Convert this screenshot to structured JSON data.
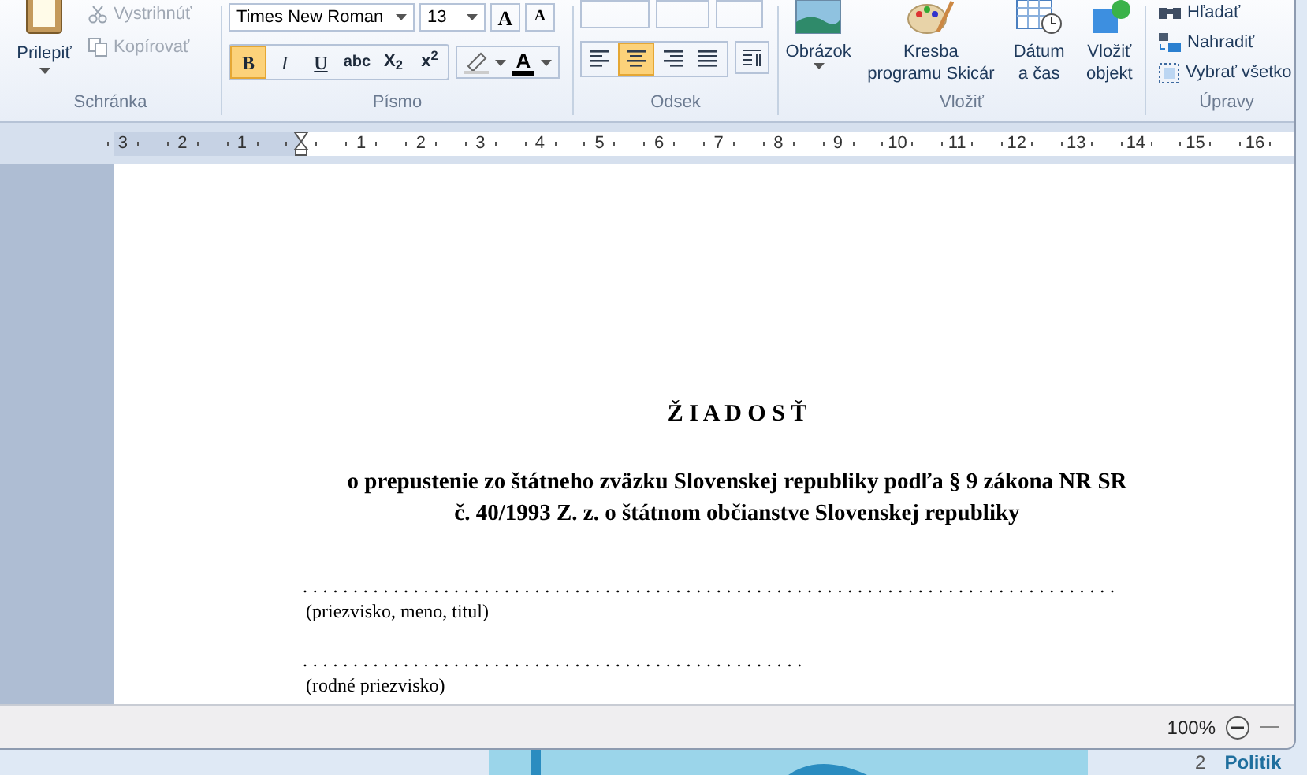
{
  "ribbon": {
    "clipboard": {
      "paste": "Prilepiť",
      "cut": {
        "label": "Vystrihnúť",
        "disabled": true
      },
      "copy": {
        "label": "Kopírovať",
        "disabled": true
      },
      "group": "Schránka"
    },
    "font": {
      "family": "Times New Roman",
      "size": "13",
      "grow": "A",
      "shrink": "A",
      "format_buttons": [
        {
          "kind": "bold",
          "label": "B",
          "selected": true
        },
        {
          "kind": "italic",
          "label": "I",
          "selected": false
        },
        {
          "kind": "underline",
          "label": "U",
          "selected": false
        },
        {
          "kind": "strike",
          "label": "abc",
          "selected": false
        },
        {
          "kind": "subscript",
          "label": "X$_{2}$",
          "selected": false
        },
        {
          "kind": "superscript",
          "label": "x$^{2}$",
          "selected": false
        }
      ],
      "color_label": "A",
      "group": "Písmo"
    },
    "paragraph": {
      "align_buttons": [
        {
          "kind": "left",
          "selected": false
        },
        {
          "kind": "center",
          "selected": true
        },
        {
          "kind": "right",
          "selected": false
        },
        {
          "kind": "justify",
          "selected": false
        }
      ],
      "group": "Odsek"
    },
    "insert": {
      "items": [
        {
          "kind": "picture",
          "label": "Obrázok"
        },
        {
          "kind": "paint",
          "label": "Kresba programu Skicár"
        },
        {
          "kind": "date",
          "label": "Dátum a čas"
        },
        {
          "kind": "object",
          "label": "Vložiť objekt"
        }
      ],
      "group": "Vložiť"
    },
    "editing": {
      "items": [
        {
          "kind": "find",
          "label": "Hľadať"
        },
        {
          "kind": "replace",
          "label": "Nahradiť"
        },
        {
          "kind": "select",
          "label": "Vybrať všetko"
        }
      ],
      "group": "Úpravy"
    }
  },
  "ruler": {
    "left_labels": [
      "3",
      "2",
      "1"
    ],
    "labels": [
      "1",
      "2",
      "3",
      "4",
      "5",
      "6",
      "7",
      "8",
      "9",
      "10",
      "11",
      "12",
      "13",
      "14",
      "15",
      "16"
    ]
  },
  "document": {
    "title": "Ž I A D O S Ť",
    "subtitle": [
      "o prepustenie zo štátneho zväzku Slovenskej republiky podľa § 9 zákona NR SR",
      "č. 40/1993 Z. z. o štátnom občianstve Slovenskej republiky"
    ],
    "fields": [
      {
        "dots": ". . . . . . . . . . . . . . . . . . . . . . . . . . . . . . . . . . . . . . . . . . . . . . . . . . . . . . . . . . . . . . . . . . . . . . . . . . . . . . . . .",
        "label": "(priezvisko, meno, titul)"
      },
      {
        "dots": ". . . . . . . . . . . . . . . . . . . . . . . . . . . . . . . . . . . . . . . . . . . . . . . . . .",
        "label": "(rodné priezvisko)"
      }
    ]
  },
  "status_bar": {
    "zoom": "100%"
  },
  "background": {
    "number": "2",
    "link": "Politik"
  }
}
